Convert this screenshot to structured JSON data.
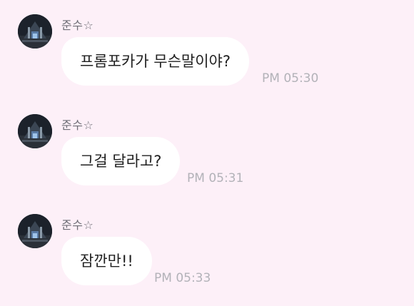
{
  "messages": [
    {
      "sender": "준수☆",
      "text": "프롬포카가 무슨말이야?",
      "time": "PM 05:30"
    },
    {
      "sender": "준수☆",
      "text": "그걸 달라고?",
      "time": "PM 05:31"
    },
    {
      "sender": "준수☆",
      "text": "잠깐만!!",
      "time": "PM 05:33"
    }
  ],
  "colors": {
    "background": "#fdf0f8",
    "bubble": "#ffffff",
    "time": "#b2b2b8",
    "sender": "#6e6e76"
  }
}
